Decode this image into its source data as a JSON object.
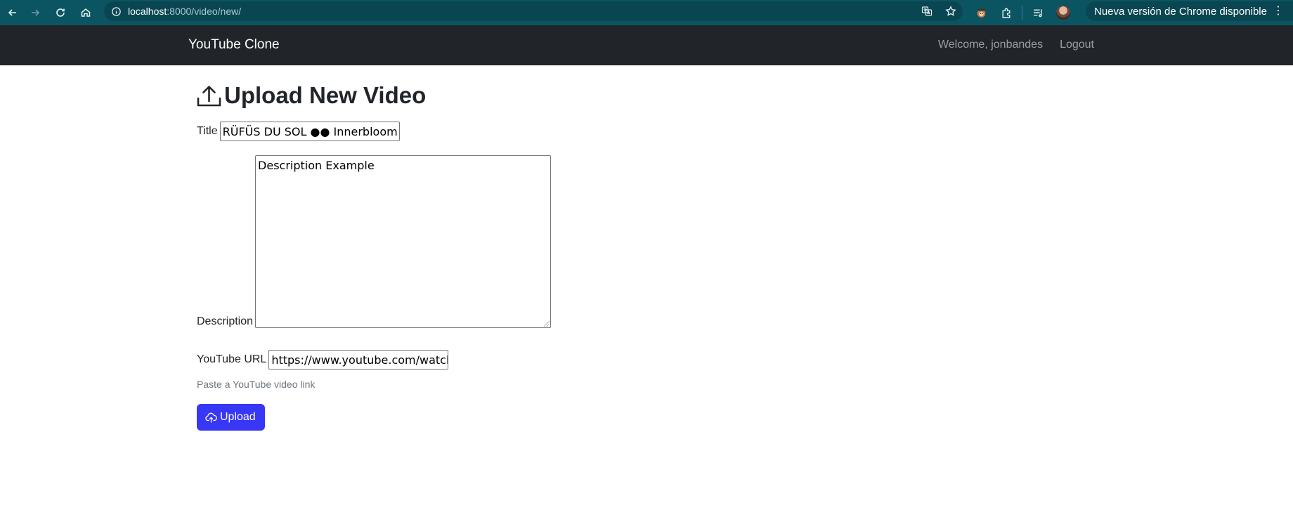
{
  "browser": {
    "url_host": "localhost",
    "url_path": ":8000/video/new/",
    "update_label": "Nueva versión de Chrome disponible",
    "menu_glyph": "⋮"
  },
  "navbar": {
    "brand": "YouTube Clone",
    "welcome": "Welcome, jonbandes",
    "logout": "Logout"
  },
  "form": {
    "heading": "Upload New Video",
    "title_label": "Title",
    "title_value": "RÜFÜS DU SOL ●● Innerbloom (Offi",
    "description_label": "Description",
    "description_value": "Description Example",
    "url_label": "YouTube URL",
    "url_value": "https://www.youtube.com/watch?",
    "url_help": "Paste a YouTube video link",
    "submit_label": "Upload"
  },
  "colors": {
    "chrome_bar": "#0b5563",
    "navbar": "#212529",
    "primary_button": "#3737f5"
  }
}
